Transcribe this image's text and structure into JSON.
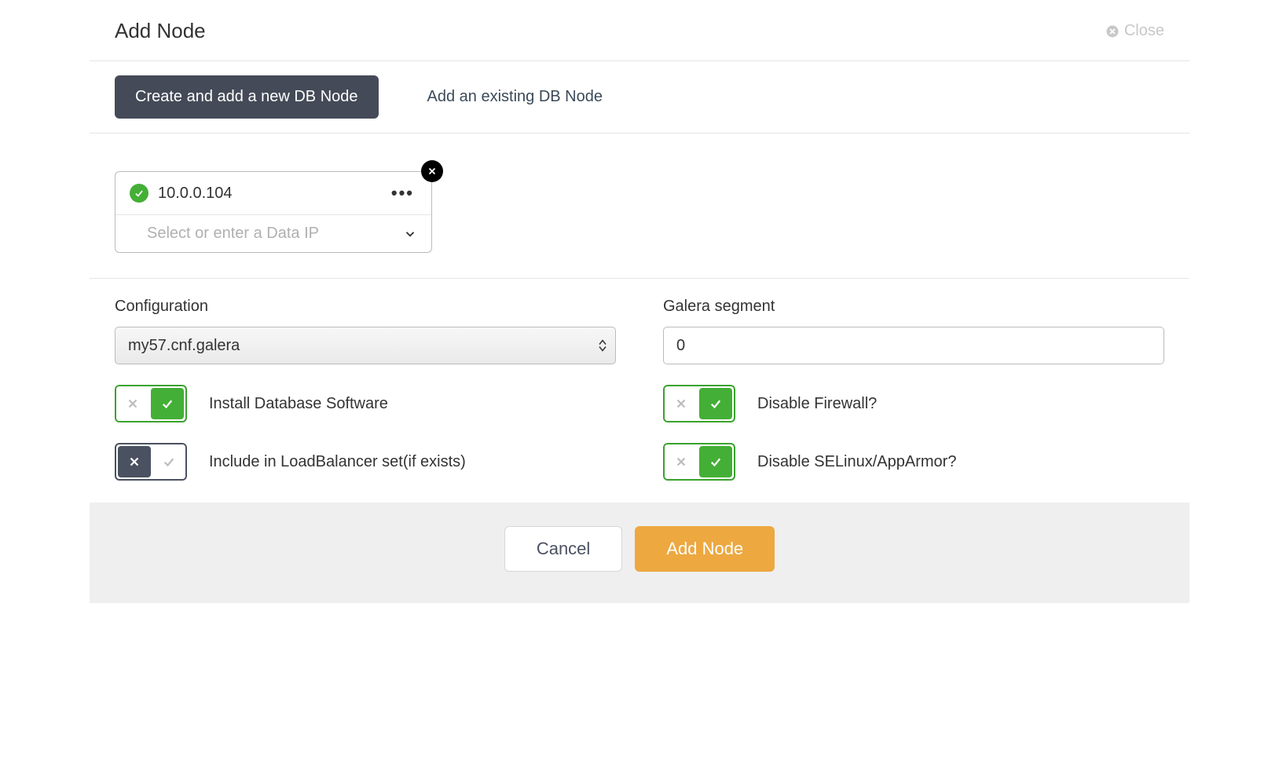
{
  "header": {
    "title": "Add Node",
    "close_label": "Close"
  },
  "tabs": {
    "create_label": "Create and add a new DB Node",
    "existing_label": "Add an existing DB Node"
  },
  "node": {
    "ip": "10.0.0.104",
    "data_ip_placeholder": "Select or enter a Data IP"
  },
  "config": {
    "left_label": "Configuration",
    "select_value": "my57.cnf.galera",
    "right_label": "Galera segment",
    "segment_value": "0",
    "toggles": {
      "install_db": {
        "label": "Install Database Software",
        "on": true
      },
      "include_lb": {
        "label": "Include in LoadBalancer set(if exists)",
        "on": false
      },
      "disable_fw": {
        "label": "Disable Firewall?",
        "on": true
      },
      "disable_selinux": {
        "label": "Disable SELinux/AppArmor?",
        "on": true
      }
    }
  },
  "footer": {
    "cancel_label": "Cancel",
    "submit_label": "Add Node"
  }
}
